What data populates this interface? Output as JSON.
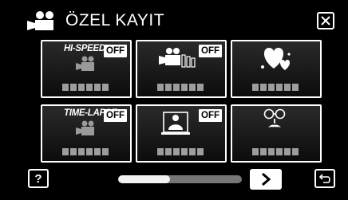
{
  "header": {
    "title": "ÖZEL KAYIT",
    "mode_icon": "movie-camera-icon",
    "close_icon": "close-icon"
  },
  "tiles": [
    {
      "name": "hi-speed",
      "mode_text": "HI-SPEED",
      "badge": "OFF",
      "icon": "hi-speed-camera-icon"
    },
    {
      "name": "continuous-record",
      "mode_text": "",
      "badge": "OFF",
      "icon": "camera-frames-icon"
    },
    {
      "name": "hearts",
      "mode_text": "",
      "badge": "",
      "icon": "hearts-icon"
    },
    {
      "name": "time-lapse",
      "mode_text": "TIME-LAPSE",
      "badge": "OFF",
      "icon": "time-lapse-camera-icon"
    },
    {
      "name": "person-frame",
      "mode_text": "",
      "badge": "OFF",
      "icon": "person-frame-icon"
    },
    {
      "name": "face-glasses",
      "mode_text": "",
      "badge": "",
      "icon": "face-glasses-mustache-icon"
    }
  ],
  "footer": {
    "help_label": "?",
    "scroll_progress": 0.42,
    "next_icon": "chevron-right-icon",
    "back_icon": "return-arrow-icon"
  },
  "colors": {
    "background": "#000000",
    "text": "#ffffff",
    "label_placeholder": "#9d9d9d",
    "slider_track": "#777777",
    "slider_fill": "#f2f2f2"
  }
}
